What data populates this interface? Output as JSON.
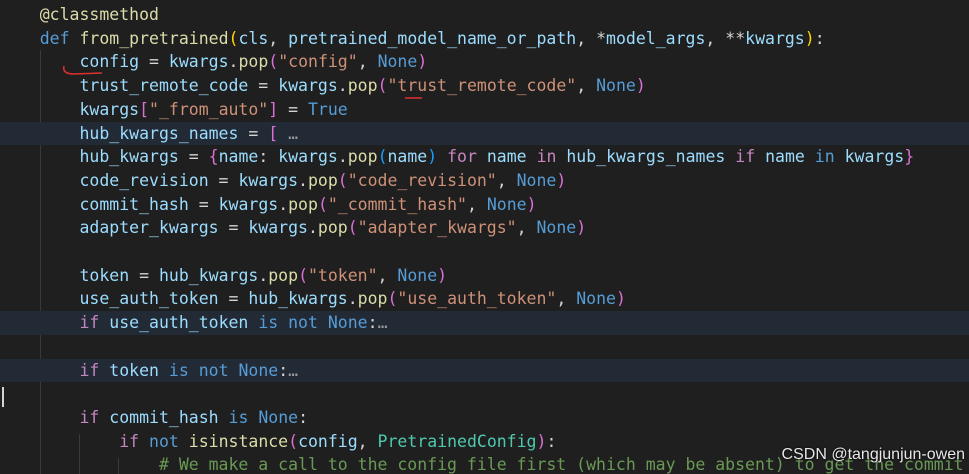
{
  "editor": {
    "lines": [
      {
        "hl": false,
        "segments": [
          [
            "    ",
            "pl"
          ],
          [
            "@classmethod",
            "dec"
          ]
        ]
      },
      {
        "hl": false,
        "segments": [
          [
            "    ",
            "pl"
          ],
          [
            "def",
            "kw"
          ],
          [
            " ",
            "pl"
          ],
          [
            "from_pretrained",
            "fn"
          ],
          [
            "(",
            "br1"
          ],
          [
            "cls",
            "par"
          ],
          [
            ", ",
            "pl"
          ],
          [
            "pretrained_model_name_or_path",
            "par"
          ],
          [
            ", *",
            "pl"
          ],
          [
            "model_args",
            "par"
          ],
          [
            ", **",
            "pl"
          ],
          [
            "kwargs",
            "par"
          ],
          [
            ")",
            "br1"
          ],
          [
            ":",
            "pl"
          ]
        ]
      },
      {
        "hl": false,
        "segments": [
          [
            "        ",
            "pl"
          ],
          [
            "config",
            "var"
          ],
          [
            " = ",
            "pl"
          ],
          [
            "kwargs",
            "var"
          ],
          [
            ".",
            "pl"
          ],
          [
            "pop",
            "fn"
          ],
          [
            "(",
            "br2"
          ],
          [
            "\"config\"",
            "str"
          ],
          [
            ", ",
            "pl"
          ],
          [
            "None",
            "kw"
          ],
          [
            ")",
            "br2"
          ]
        ]
      },
      {
        "hl": false,
        "segments": [
          [
            "        ",
            "pl"
          ],
          [
            "trust_remote_code",
            "var"
          ],
          [
            " = ",
            "pl"
          ],
          [
            "kwargs",
            "var"
          ],
          [
            ".",
            "pl"
          ],
          [
            "pop",
            "fn"
          ],
          [
            "(",
            "br2"
          ],
          [
            "\"trust_remote_code\"",
            "str"
          ],
          [
            ", ",
            "pl"
          ],
          [
            "None",
            "kw"
          ],
          [
            ")",
            "br2"
          ]
        ]
      },
      {
        "hl": false,
        "segments": [
          [
            "        ",
            "pl"
          ],
          [
            "kwargs",
            "var"
          ],
          [
            "[",
            "br2"
          ],
          [
            "\"_from_auto\"",
            "str"
          ],
          [
            "]",
            "br2"
          ],
          [
            " = ",
            "pl"
          ],
          [
            "True",
            "kw"
          ]
        ]
      },
      {
        "hl": true,
        "segments": [
          [
            "        ",
            "pl"
          ],
          [
            "hub_kwargs_names",
            "var"
          ],
          [
            " = ",
            "pl"
          ],
          [
            "[",
            "br2"
          ],
          [
            " …",
            "fold"
          ]
        ]
      },
      {
        "hl": false,
        "segments": [
          [
            "        ",
            "pl"
          ],
          [
            "hub_kwargs",
            "var"
          ],
          [
            " = ",
            "pl"
          ],
          [
            "{",
            "br2"
          ],
          [
            "name",
            "var"
          ],
          [
            ": ",
            "pl"
          ],
          [
            "kwargs",
            "var"
          ],
          [
            ".",
            "pl"
          ],
          [
            "pop",
            "fn"
          ],
          [
            "(",
            "br3"
          ],
          [
            "name",
            "var"
          ],
          [
            ")",
            "br3"
          ],
          [
            " ",
            "pl"
          ],
          [
            "for",
            "ctl"
          ],
          [
            " ",
            "pl"
          ],
          [
            "name",
            "var"
          ],
          [
            " ",
            "pl"
          ],
          [
            "in",
            "ctl"
          ],
          [
            " ",
            "pl"
          ],
          [
            "hub_kwargs_names",
            "var"
          ],
          [
            " ",
            "pl"
          ],
          [
            "if",
            "ctl"
          ],
          [
            " ",
            "pl"
          ],
          [
            "name",
            "var"
          ],
          [
            " ",
            "pl"
          ],
          [
            "in",
            "kw"
          ],
          [
            " ",
            "pl"
          ],
          [
            "kwargs",
            "var"
          ],
          [
            "}",
            "br2"
          ]
        ]
      },
      {
        "hl": false,
        "segments": [
          [
            "        ",
            "pl"
          ],
          [
            "code_revision",
            "var"
          ],
          [
            " = ",
            "pl"
          ],
          [
            "kwargs",
            "var"
          ],
          [
            ".",
            "pl"
          ],
          [
            "pop",
            "fn"
          ],
          [
            "(",
            "br2"
          ],
          [
            "\"code_revision\"",
            "str"
          ],
          [
            ", ",
            "pl"
          ],
          [
            "None",
            "kw"
          ],
          [
            ")",
            "br2"
          ]
        ]
      },
      {
        "hl": false,
        "segments": [
          [
            "        ",
            "pl"
          ],
          [
            "commit_hash",
            "var"
          ],
          [
            " = ",
            "pl"
          ],
          [
            "kwargs",
            "var"
          ],
          [
            ".",
            "pl"
          ],
          [
            "pop",
            "fn"
          ],
          [
            "(",
            "br2"
          ],
          [
            "\"_commit_hash\"",
            "str"
          ],
          [
            ", ",
            "pl"
          ],
          [
            "None",
            "kw"
          ],
          [
            ")",
            "br2"
          ]
        ]
      },
      {
        "hl": false,
        "segments": [
          [
            "        ",
            "pl"
          ],
          [
            "adapter_kwargs",
            "var"
          ],
          [
            " = ",
            "pl"
          ],
          [
            "kwargs",
            "var"
          ],
          [
            ".",
            "pl"
          ],
          [
            "pop",
            "fn"
          ],
          [
            "(",
            "br2"
          ],
          [
            "\"adapter_kwargs\"",
            "str"
          ],
          [
            ", ",
            "pl"
          ],
          [
            "None",
            "kw"
          ],
          [
            ")",
            "br2"
          ]
        ]
      },
      {
        "hl": false,
        "segments": []
      },
      {
        "hl": false,
        "segments": [
          [
            "        ",
            "pl"
          ],
          [
            "token",
            "var"
          ],
          [
            " = ",
            "pl"
          ],
          [
            "hub_kwargs",
            "var"
          ],
          [
            ".",
            "pl"
          ],
          [
            "pop",
            "fn"
          ],
          [
            "(",
            "br2"
          ],
          [
            "\"token\"",
            "str"
          ],
          [
            ", ",
            "pl"
          ],
          [
            "None",
            "kw"
          ],
          [
            ")",
            "br2"
          ]
        ]
      },
      {
        "hl": false,
        "segments": [
          [
            "        ",
            "pl"
          ],
          [
            "use_auth_token",
            "var"
          ],
          [
            " = ",
            "pl"
          ],
          [
            "hub_kwargs",
            "var"
          ],
          [
            ".",
            "pl"
          ],
          [
            "pop",
            "fn"
          ],
          [
            "(",
            "br2"
          ],
          [
            "\"use_auth_token\"",
            "str"
          ],
          [
            ", ",
            "pl"
          ],
          [
            "None",
            "kw"
          ],
          [
            ")",
            "br2"
          ]
        ]
      },
      {
        "hl": true,
        "segments": [
          [
            "        ",
            "pl"
          ],
          [
            "if",
            "ctl"
          ],
          [
            " ",
            "pl"
          ],
          [
            "use_auth_token",
            "var"
          ],
          [
            " ",
            "pl"
          ],
          [
            "is",
            "kw"
          ],
          [
            " ",
            "pl"
          ],
          [
            "not",
            "kw"
          ],
          [
            " ",
            "pl"
          ],
          [
            "None",
            "kw"
          ],
          [
            ":",
            "pl"
          ],
          [
            "…",
            "fold"
          ]
        ]
      },
      {
        "hl": false,
        "segments": []
      },
      {
        "hl": true,
        "segments": [
          [
            "        ",
            "pl"
          ],
          [
            "if",
            "ctl"
          ],
          [
            " ",
            "pl"
          ],
          [
            "token",
            "var"
          ],
          [
            " ",
            "pl"
          ],
          [
            "is",
            "kw"
          ],
          [
            " ",
            "pl"
          ],
          [
            "not",
            "kw"
          ],
          [
            " ",
            "pl"
          ],
          [
            "None",
            "kw"
          ],
          [
            ":",
            "pl"
          ],
          [
            "…",
            "fold"
          ]
        ]
      },
      {
        "hl": false,
        "segments": []
      },
      {
        "hl": false,
        "segments": [
          [
            "        ",
            "pl"
          ],
          [
            "if",
            "ctl"
          ],
          [
            " ",
            "pl"
          ],
          [
            "commit_hash",
            "var"
          ],
          [
            " ",
            "pl"
          ],
          [
            "is",
            "kw"
          ],
          [
            " ",
            "pl"
          ],
          [
            "None",
            "kw"
          ],
          [
            ":",
            "pl"
          ]
        ]
      },
      {
        "hl": false,
        "segments": [
          [
            "            ",
            "pl"
          ],
          [
            "if",
            "ctl"
          ],
          [
            " ",
            "pl"
          ],
          [
            "not",
            "kw"
          ],
          [
            " ",
            "pl"
          ],
          [
            "isinstance",
            "fn"
          ],
          [
            "(",
            "br2"
          ],
          [
            "config",
            "var"
          ],
          [
            ", ",
            "pl"
          ],
          [
            "PretrainedConfig",
            "cls"
          ],
          [
            ")",
            "br2"
          ],
          [
            ":",
            "pl"
          ]
        ]
      },
      {
        "hl": false,
        "segments": [
          [
            "                ",
            "pl"
          ],
          [
            "# We make a call to the config file first (which may be absent) to get the commit hash",
            "cmt"
          ]
        ]
      }
    ]
  },
  "watermark": "CSDN @tangjunjun-owen",
  "annotations": {
    "color": "#e03030"
  }
}
